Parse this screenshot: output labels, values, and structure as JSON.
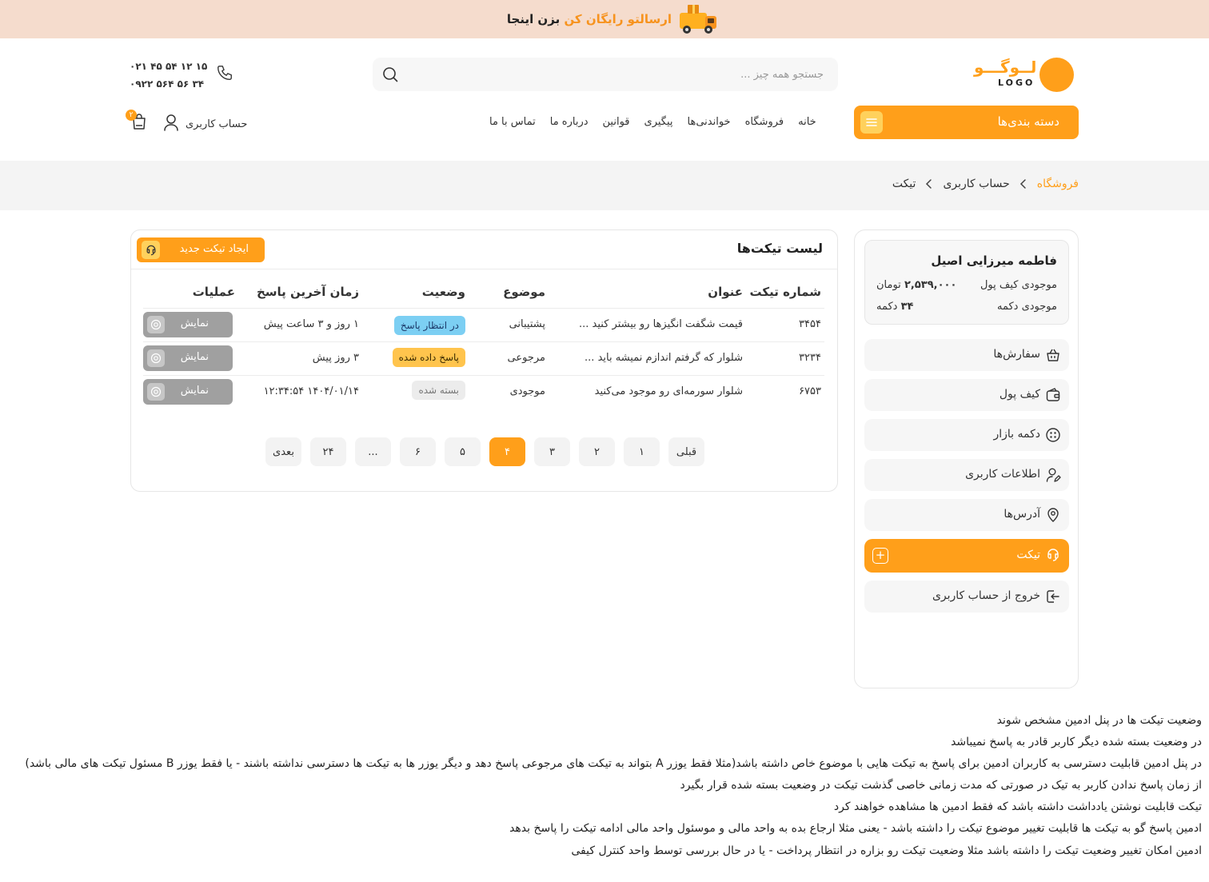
{
  "banner": {
    "prefix": "بزن اینجا",
    "highlight": "ارسالتو رایگان کن"
  },
  "logo": {
    "fa": "لــوگـــو",
    "en": "LOGO"
  },
  "search": {
    "placeholder": "جستجو همه چیز ..."
  },
  "phones": {
    "line1": "۰۲۱ ۴۵ ۵۴ ۱۲ ۱۵",
    "line2": "۰۹۲۲ ۵۶۴ ۵۶ ۳۴"
  },
  "categories": {
    "label": "دسته بندی‌ها"
  },
  "nav": [
    "خانه",
    "فروشگاه",
    "خواندنی‌ها",
    "پیگیری",
    "قوانین",
    "درباره ما",
    "تماس با ما"
  ],
  "account": {
    "label": "حساب کاربری",
    "cart_count": "۲"
  },
  "breadcrumb": [
    "فروشگاه",
    "حساب کاربری",
    "تیکت"
  ],
  "user": {
    "name": "فاطمه میرزایی اصیل",
    "wallet_label": "موجودی کیف پول",
    "wallet_value": "۲,۵۳۹,۰۰۰",
    "wallet_unit": "تومان",
    "button_label": "موجودی دکمه",
    "button_value": "۳۴",
    "button_unit": "دکمه"
  },
  "sidebar_menu": [
    {
      "label": "سفارش‌ها",
      "icon": "basket-icon"
    },
    {
      "label": "کیف پول",
      "icon": "wallet-icon"
    },
    {
      "label": "دکمه بازار",
      "icon": "button-icon"
    },
    {
      "label": "اطلاعات کاربری",
      "icon": "user-edit-icon"
    },
    {
      "label": "آدرس‌ها",
      "icon": "location-icon"
    },
    {
      "label": "تیکت",
      "icon": "ticket-icon",
      "active": true
    },
    {
      "label": "خروج از حساب کاربری",
      "icon": "logout-icon"
    }
  ],
  "tickets": {
    "title": "لیست تیکت‌ها",
    "new_button": "ایجاد تیکت جدید",
    "columns": [
      "شماره تیکت",
      "عنوان",
      "موضوع",
      "وضعیت",
      "زمان آخرین پاسخ",
      "عملیات"
    ],
    "rows": [
      {
        "number": "۳۴۵۴",
        "title": "قیمت شگفت انگیزها رو بیشتر کنید ...",
        "subject": "پشتیبانی",
        "status": "در انتظار پاسخ",
        "last_reply": "۱ روز و ۳ ساعت پیش",
        "action": "نمایش"
      },
      {
        "number": "۳۲۳۴",
        "title": "شلوار که گرفتم اندازم نمیشه باید ...",
        "subject": "مرجوعی",
        "status": "پاسخ داده شده",
        "last_reply": "۳ روز پیش",
        "action": "نمایش"
      },
      {
        "number": "۶۷۵۳",
        "title": "شلوار سورمه‌ای رو موجود می‌کنید",
        "subject": "موجودی",
        "status": "بسته شده",
        "last_reply": "۱۴۰۴/۰۱/۱۴ ۱۲:۳۴:۵۴",
        "action": "نمایش"
      }
    ]
  },
  "pagination": {
    "items": [
      "قبلی",
      "۱",
      "۲",
      "۳",
      "۴",
      "۵",
      "۶",
      "...",
      "۲۴",
      "بعدی"
    ],
    "active": "۴"
  },
  "notes": [
    "وضعیت تیکت ها در پنل ادمین مشخص شوند",
    "در وضعیت بسته شده دیگر کاربر قادر به پاسخ نمیباشد",
    "در پنل ادمین قابلیت دسترسی به کاربران ادمین برای پاسخ به تیکت هایی با موضوع خاص داشته باشد(مثلا فقط یوزر A بتواند به تیکت های مرجوعی پاسخ دهد و دیگر یوزر ها به تیکت ها دسترسی نداشته باشند - یا فقط یوزر B مسئول تیکت های مالی باشد)",
    "از زمان پاسخ ندادن کاربر به تیک در صورتی که مدت زمانی خاصی گذشت تیکت در وضعیت بسته شده قرار بگیرد",
    "تیکت قابلیت نوشتن یادداشت داشته باشد که فقط ادمین ها مشاهده خواهند کرد",
    "ادمین پاسخ گو به تیکت ها قابلیت تغییر موضوع تیکت را داشته باشد - یعنی مثلا ارجاع بده به واحد مالی و موسئول واحد مالی ادامه تیکت را پاسخ بدهد",
    "ادمین امکان تغییر وضعیت تیکت را داشته باشد مثلا وضعیت تیکت رو بزاره در انتظار پرداخت - یا در حال بررسی توسط واحد کنترل کیفی"
  ],
  "colors": {
    "accent": "#ff9f1a",
    "accent_light": "#ffd15c",
    "banner_bg": "#f5dccd"
  }
}
